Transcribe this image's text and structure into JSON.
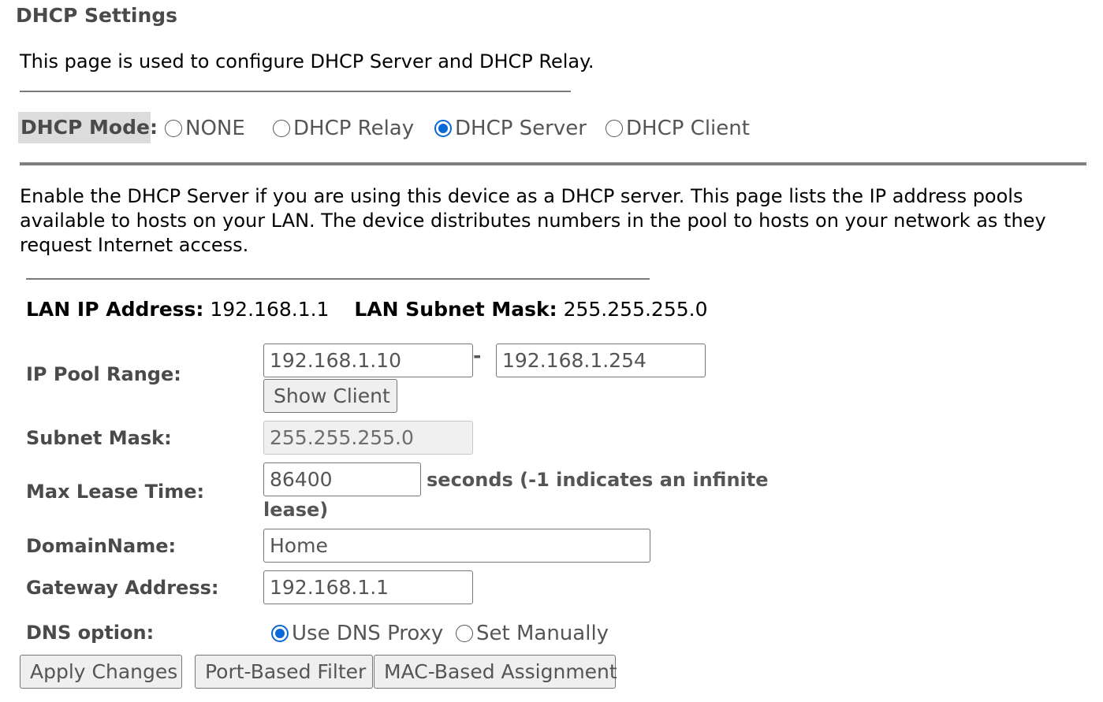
{
  "page": {
    "title": "DHCP Settings",
    "intro": "This page is used to configure DHCP Server and DHCP Relay."
  },
  "mode": {
    "label": "DHCP Mode:",
    "options": [
      {
        "label": "NONE",
        "selected": false
      },
      {
        "label": "DHCP Relay",
        "selected": false
      },
      {
        "label": "DHCP Server",
        "selected": true
      },
      {
        "label": "DHCP Client",
        "selected": false
      }
    ]
  },
  "description": "Enable the DHCP Server if you are using this device as a DHCP server. This page lists the IP address pools available to hosts on your LAN. The device distributes numbers in the pool to hosts on your network as they request Internet access.",
  "lan": {
    "ip_label": "LAN IP Address:",
    "ip_value": "192.168.1.1",
    "mask_label": "LAN Subnet Mask:",
    "mask_value": "255.255.255.0"
  },
  "form": {
    "pool_label": "IP Pool Range:",
    "pool_start": "192.168.1.10",
    "pool_separator": "-",
    "pool_end": "192.168.1.254",
    "show_client_label": "Show Client",
    "subnet_label": "Subnet Mask:",
    "subnet_value": "255.255.255.0",
    "lease_label": "Max Lease Time:",
    "lease_value": "86400",
    "lease_unit_line1": "seconds (-1 indicates an infinite",
    "lease_unit_line2": "lease)",
    "domain_label": "DomainName:",
    "domain_value": "Home",
    "gateway_label": "Gateway Address:",
    "gateway_value": "192.168.1.1",
    "dns_label": "DNS option:",
    "dns_options": [
      {
        "label": "Use DNS Proxy",
        "selected": true
      },
      {
        "label": "Set Manually",
        "selected": false
      }
    ]
  },
  "buttons": {
    "apply": "Apply Changes",
    "port_filter": "Port-Based Filter",
    "mac_assignment": "MAC-Based Assignment"
  },
  "colors": {
    "accent": "#0a68d8",
    "label_gray": "#4a4a4a"
  }
}
